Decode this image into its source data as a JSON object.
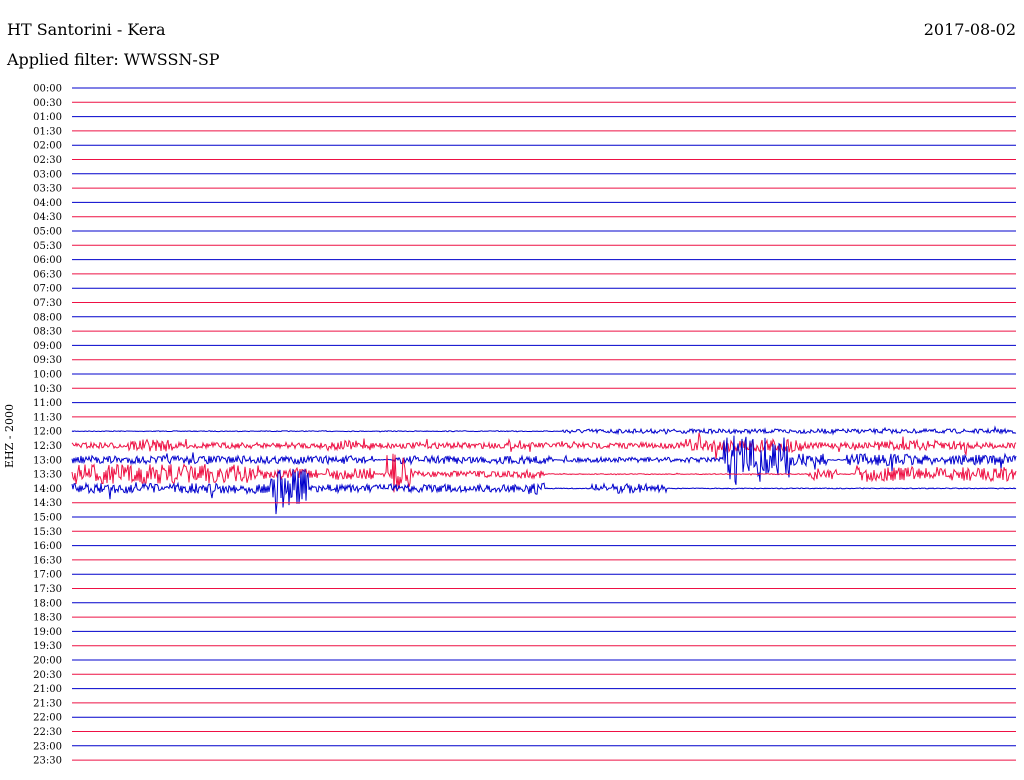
{
  "header": {
    "station_title": "HT Santorini - Kera",
    "date": "2017-08-02",
    "filter": "Applied filter: WWSSN-SP"
  },
  "channel_label": "EHZ - 2000",
  "colors": {
    "even_trace": "#0000cc",
    "odd_trace": "#ee1144",
    "background": "#ffffff"
  },
  "chart_data": {
    "type": "line",
    "ylabels": [
      "00:00",
      "00:30",
      "01:00",
      "01:30",
      "02:00",
      "02:30",
      "03:00",
      "03:30",
      "04:00",
      "04:30",
      "05:00",
      "05:30",
      "06:00",
      "06:30",
      "07:00",
      "07:30",
      "08:00",
      "08:30",
      "09:00",
      "09:30",
      "10:00",
      "10:30",
      "11:00",
      "11:30",
      "12:00",
      "12:30",
      "13:00",
      "13:30",
      "14:00",
      "14:30",
      "15:00",
      "15:30",
      "16:00",
      "16:30",
      "17:00",
      "17:30",
      "18:00",
      "18:30",
      "19:00",
      "19:30",
      "20:00",
      "20:30",
      "21:00",
      "21:30",
      "22:00",
      "22:30",
      "23:00",
      "23:30"
    ],
    "activity": [
      {
        "row": 24,
        "segments": [
          [
            0.5,
            0.52,
            0.3
          ],
          [
            0.52,
            1.0,
            2.2
          ]
        ]
      },
      {
        "row": 25,
        "segments": [
          [
            0.0,
            1.0,
            3.0
          ],
          [
            0.06,
            0.11,
            6
          ],
          [
            0.27,
            0.31,
            5
          ],
          [
            0.65,
            0.78,
            7
          ],
          [
            0.85,
            0.95,
            5
          ]
        ]
      },
      {
        "row": 26,
        "segments": [
          [
            0.0,
            0.32,
            4
          ],
          [
            0.34,
            0.51,
            4
          ],
          [
            0.52,
            0.69,
            2.5
          ],
          [
            0.69,
            0.76,
            25
          ],
          [
            0.76,
            0.8,
            6
          ],
          [
            0.82,
            0.9,
            6
          ],
          [
            0.9,
            1.0,
            5
          ]
        ]
      },
      {
        "row": 27,
        "segments": [
          [
            0.0,
            0.2,
            10
          ],
          [
            0.2,
            0.26,
            5
          ],
          [
            0.27,
            0.32,
            6
          ],
          [
            0.33,
            0.36,
            20
          ],
          [
            0.36,
            0.47,
            3
          ],
          [
            0.47,
            0.5,
            4
          ],
          [
            0.78,
            0.81,
            6
          ],
          [
            0.83,
            1.0,
            7
          ]
        ]
      },
      {
        "row": 28,
        "segments": [
          [
            0.0,
            0.21,
            5
          ],
          [
            0.21,
            0.25,
            20
          ],
          [
            0.25,
            0.48,
            4
          ],
          [
            0.48,
            0.5,
            6
          ],
          [
            0.55,
            0.61,
            5
          ],
          [
            0.61,
            0.63,
            4
          ]
        ]
      }
    ]
  }
}
